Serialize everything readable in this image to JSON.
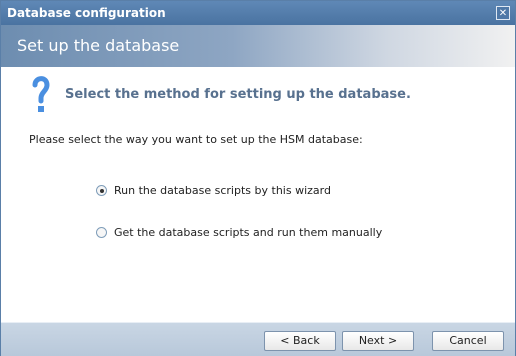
{
  "window": {
    "title": "Database configuration"
  },
  "header": {
    "title": "Set up the database"
  },
  "content": {
    "subtitle": "Select the method for setting up the database.",
    "prompt": "Please select the way you want to set up the HSM database:",
    "options": [
      {
        "label": "Run the database scripts by this wizard",
        "selected": true
      },
      {
        "label": "Get the database scripts and run them manually",
        "selected": false
      }
    ]
  },
  "buttons": {
    "back": "< Back",
    "next": "Next >",
    "cancel": "Cancel"
  },
  "icons": {
    "close": "close-icon",
    "help": "question-mark-icon"
  }
}
